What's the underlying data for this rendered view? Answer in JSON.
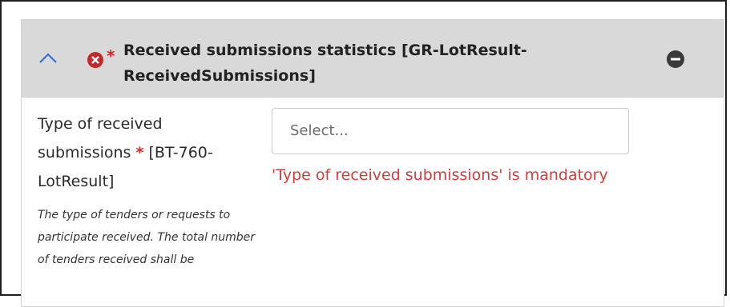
{
  "panel": {
    "title": "Received submissions statistics  [GR-LotResult-ReceivedSubmissions]",
    "required_marker": "*",
    "icons": {
      "collapse": "chevron-up-icon",
      "error": "error-circle-icon",
      "remove": "minus-circle-icon"
    },
    "colors": {
      "header_bg": "#d9d9d9",
      "error": "#d93a3a",
      "required": "#dd2222",
      "chevron": "#2b6cd6"
    }
  },
  "field": {
    "label": "Type of received submissions",
    "required_marker": "*",
    "code": "[BT-760-LotResult]",
    "description": "The type of tenders or requests to participate received. The total number of tenders received shall be",
    "placeholder": "Select...",
    "error": "'Type of received submissions' is mandatory"
  }
}
